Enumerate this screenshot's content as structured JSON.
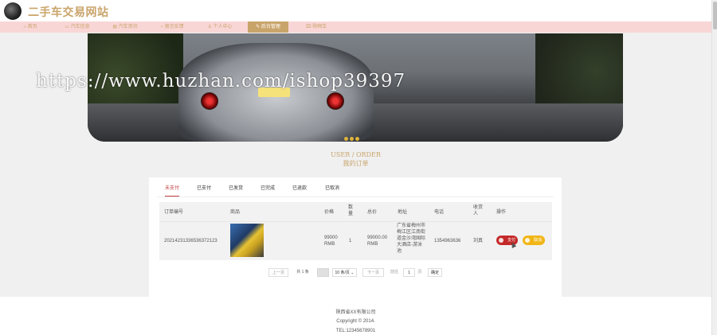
{
  "header": {
    "site_title": "二手车交易网站"
  },
  "nav": [
    {
      "label": "首页"
    },
    {
      "label": "汽车信息"
    },
    {
      "label": "汽车资讯"
    },
    {
      "label": "留言反馈"
    },
    {
      "label": "个人中心"
    },
    {
      "label": "后台管理"
    },
    {
      "label": "购物车"
    }
  ],
  "nav_active": "后台管理",
  "watermark": "https://www.huzhan.com/ishop39397",
  "section": {
    "title_en": "USER / ORDER",
    "title_cn": "我的订单"
  },
  "tabs": [
    {
      "label": "未支付"
    },
    {
      "label": "已支付"
    },
    {
      "label": "已发货"
    },
    {
      "label": "已完成"
    },
    {
      "label": "已退款"
    },
    {
      "label": "已取消"
    }
  ],
  "table": {
    "headers": [
      "订单编号",
      "商品",
      "价格",
      "数量",
      "总价",
      "地址",
      "电话",
      "收货人",
      "操作"
    ],
    "row": {
      "order_no": "20214231336536372123",
      "price": "99000 RMB",
      "qty": "1",
      "total": "99000.00 RMB",
      "address": "广东省梅州市梅江区江南街道金沙湾国际大酒店-游泳池",
      "phone": "1354963636",
      "receiver": "刘真",
      "pay_label": "支付",
      "cancel_label": "取消"
    }
  },
  "pager": {
    "prev": "上一页",
    "total": "共 1 条",
    "page_size": "10 条/页",
    "next": "下一页",
    "goto": "前往",
    "page_input": "1",
    "page_unit": "页",
    "confirm": "确定"
  },
  "footer": {
    "company": "陕西省XX有限公司",
    "copyright": "Copyright © 2014.",
    "tel": "TEL:12345678901"
  },
  "colors": {
    "accent": "#c9a46a",
    "nav_bg": "#f9d6d6",
    "pay": "#c42a2a",
    "cancel": "#f1b616"
  }
}
